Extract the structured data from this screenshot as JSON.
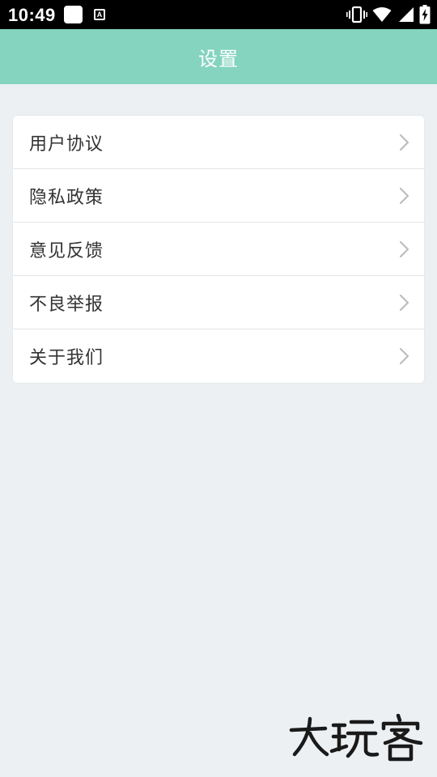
{
  "status_bar": {
    "time": "10:49",
    "notification_icons": [
      "white-square-icon",
      "a-badge-icon"
    ],
    "a_badge_text": "A",
    "system_icons": [
      "vibrate-icon",
      "wifi-icon",
      "signal-icon",
      "battery-charging-icon"
    ]
  },
  "app_bar": {
    "title": "设置",
    "background_color": "#84D4BF"
  },
  "menu": {
    "items": [
      {
        "label": "用户协议",
        "icon": "chevron-right-icon"
      },
      {
        "label": "隐私政策",
        "icon": "chevron-right-icon"
      },
      {
        "label": "意见反馈",
        "icon": "chevron-right-icon"
      },
      {
        "label": "不良举报",
        "icon": "chevron-right-icon"
      },
      {
        "label": "关于我们",
        "icon": "chevron-right-icon"
      }
    ]
  },
  "watermark": {
    "text": "大玩客"
  },
  "colors": {
    "page_background": "#ECF0F3",
    "card_background": "#FFFFFF",
    "divider": "#E2E4E6",
    "chevron": "#BDBDBD"
  }
}
